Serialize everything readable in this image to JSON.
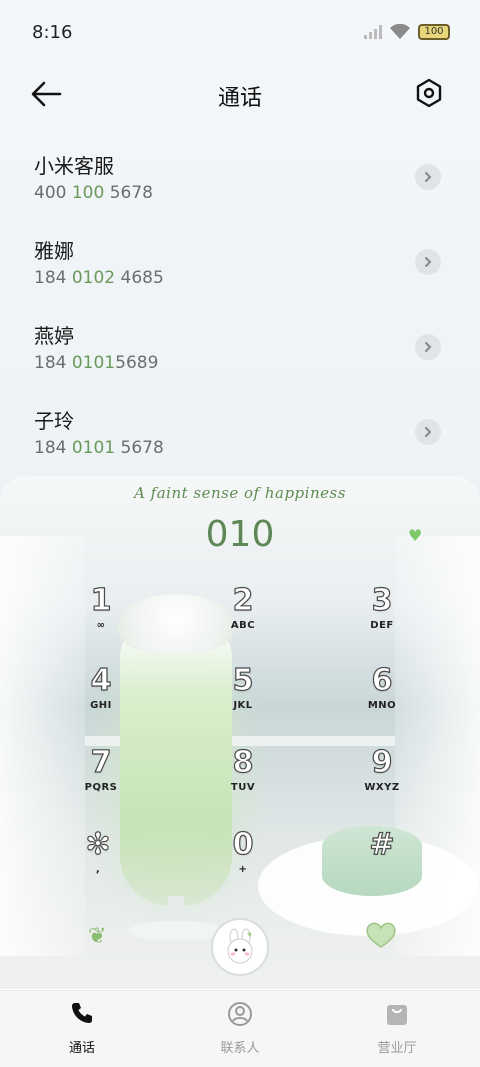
{
  "status_bar": {
    "time": "8:16",
    "battery": "100",
    "icons": [
      "signal-icon",
      "wifi-icon",
      "battery-icon"
    ]
  },
  "header": {
    "title": "通话",
    "back_icon": "arrow-left-icon",
    "settings_icon": "gear-icon"
  },
  "calls": [
    {
      "name": "小米客服",
      "number_pre": "400 ",
      "number_hl": "100",
      "number_post": " 5678"
    },
    {
      "name": "雅娜",
      "number_pre": "184 ",
      "number_hl": "0102",
      "number_post": " 4685"
    },
    {
      "name": "燕婷",
      "number_pre": "184 ",
      "number_hl": "0101",
      "number_post": "5689"
    },
    {
      "name": "子玲",
      "number_pre": "184 ",
      "number_hl": "0101",
      "number_post": " 5678"
    }
  ],
  "dialer": {
    "tagline": "A faint sense of happiness",
    "input": "010",
    "keys": [
      {
        "digit": "1",
        "letters": "∞"
      },
      {
        "digit": "2",
        "letters": "ABC"
      },
      {
        "digit": "3",
        "letters": "DEF"
      },
      {
        "digit": "4",
        "letters": "GHI"
      },
      {
        "digit": "5",
        "letters": "JKL"
      },
      {
        "digit": "6",
        "letters": "MNO"
      },
      {
        "digit": "7",
        "letters": "PQRS"
      },
      {
        "digit": "8",
        "letters": "TUV"
      },
      {
        "digit": "9",
        "letters": "WXYZ"
      },
      {
        "digit": "✻",
        "letters": ","
      },
      {
        "digit": "0",
        "letters": "+"
      },
      {
        "digit": "#",
        "letters": ""
      }
    ],
    "accent_color": "#5e8757"
  },
  "bottom_nav": [
    {
      "label": "通话",
      "icon": "phone-icon",
      "active": true
    },
    {
      "label": "联系人",
      "icon": "person-icon",
      "active": false
    },
    {
      "label": "营业厅",
      "icon": "bag-icon",
      "active": false
    }
  ]
}
